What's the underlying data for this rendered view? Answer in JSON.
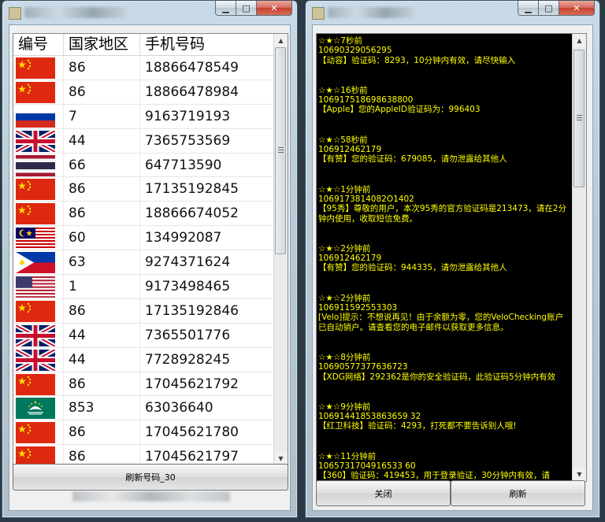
{
  "left_window": {
    "columns": [
      "编号",
      "国家地区",
      "手机号码"
    ],
    "rows": [
      {
        "flag": "cn",
        "code": "86",
        "phone": "18866478549"
      },
      {
        "flag": "cn",
        "code": "86",
        "phone": "18866478984"
      },
      {
        "flag": "ru",
        "code": "7",
        "phone": "9163719193"
      },
      {
        "flag": "gb",
        "code": "44",
        "phone": "7365753569"
      },
      {
        "flag": "th",
        "code": "66",
        "phone": "647713590"
      },
      {
        "flag": "cn",
        "code": "86",
        "phone": "17135192845"
      },
      {
        "flag": "cn",
        "code": "86",
        "phone": "18866674052"
      },
      {
        "flag": "my",
        "code": "60",
        "phone": "134992087"
      },
      {
        "flag": "ph",
        "code": "63",
        "phone": "9274371624"
      },
      {
        "flag": "us",
        "code": "1",
        "phone": "9173498465"
      },
      {
        "flag": "cn",
        "code": "86",
        "phone": "17135192846"
      },
      {
        "flag": "gb",
        "code": "44",
        "phone": "7365501776"
      },
      {
        "flag": "gb",
        "code": "44",
        "phone": "7728928245"
      },
      {
        "flag": "cn",
        "code": "86",
        "phone": "17045621792"
      },
      {
        "flag": "mo",
        "code": "853",
        "phone": "63036640"
      },
      {
        "flag": "cn",
        "code": "86",
        "phone": "17045621780"
      },
      {
        "flag": "cn",
        "code": "86",
        "phone": "17045621797"
      }
    ],
    "refresh_label": "刷新号码_30"
  },
  "right_window": {
    "messages": [
      {
        "time": "☆★☆7秒前",
        "num": "10690329056295",
        "text": "【动容】验证码：8293，10分钟内有效，请尽快输入"
      },
      {
        "time": "☆★☆16秒前",
        "num": "106917518698638800",
        "text": "【Apple】您的AppleID验证码为：996403"
      },
      {
        "time": "☆★☆58秒前",
        "num": "106912462179",
        "text": "【有赞】您的验证码：679085，请勿泄露给其他人"
      },
      {
        "time": "☆★☆1分钟前",
        "num": "1069173814082O1402",
        "text": "【95秀】尊敬的用户，本次95秀的官方验证码是213473，请在2分钟内使用，收取短信免费。"
      },
      {
        "time": "☆★☆2分钟前",
        "num": "106912462179",
        "text": "【有赞】您的验证码：944335，请勿泄露给其他人"
      },
      {
        "time": "☆★☆2分钟前",
        "num": "106911592553303",
        "text": "[Velo]提示：不想说再见！由于余额为零，您的VeloChecking账户已自动销户。请查看您的电子邮件以获取更多信息。"
      },
      {
        "time": "☆★☆8分钟前",
        "num": "10690577377636723",
        "text": "【XDG网络】292362是你的安全验证码，此验证码5分钟内有效"
      },
      {
        "time": "☆★☆9分钟前",
        "num": "10691441853863659 32",
        "text": "【红卫科技】验证码：4293，打死都不要告诉别人哦!"
      },
      {
        "time": "☆★☆11分钟前",
        "num": "1065731704916533 60",
        "text": "【360】验证码：419453，用于登录验证，30分钟内有效，请"
      }
    ],
    "close_label": "关闭",
    "refresh_label": "刷新"
  },
  "colors": {
    "sms_text": "#ffff00",
    "sms_bg": "#000000",
    "close_red": "#c4402f"
  },
  "icons": {
    "minimize": "minimize-icon",
    "maximize": "maximize-icon",
    "close": "close-icon"
  }
}
